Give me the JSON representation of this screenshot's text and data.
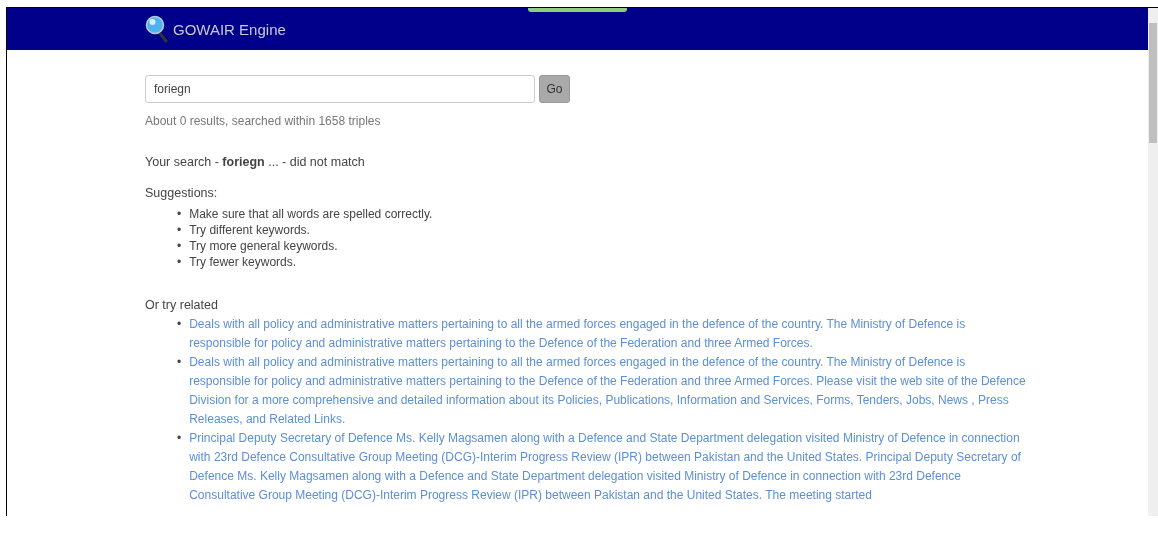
{
  "header": {
    "brand": "GOWAIR Engine"
  },
  "search": {
    "value": "foriegn",
    "button": "Go"
  },
  "result_count": "About 0 results, searched within 1658 triples",
  "no_match": "Your search - **foriegn** ... - did not match",
  "suggestions": {
    "title": "Suggestions:",
    "items": [
      {
        "bullet": "•",
        "text": "Make sure that all words are spelled correctly."
      },
      {
        "bullet": "•",
        "text": "Try different keywords."
      },
      {
        "bullet": "•",
        "text": "Try more general keywords."
      },
      {
        "bullet": "•",
        "text": "Try fewer keywords."
      }
    ]
  },
  "related": {
    "title": "Or try related",
    "items": [
      {
        "bullet": "•",
        "text": "Deals with all policy and administrative matters pertaining to all the armed forces engaged in the defence of the country. The Ministry of Defence is responsible for policy and administrative matters pertaining to the Defence of the Federation and three Armed Forces."
      },
      {
        "bullet": "•",
        "text": "Deals with all policy and administrative matters pertaining to all the armed forces engaged in the defence of the country. The Ministry of Defence is responsible for policy and administrative matters pertaining to the Defence of the Federation and three Armed Forces. Please visit the web site of the Defence Division for a more comprehensive and detailed information about its Policies, Publications, Information and Services, Forms, Tenders, Jobs, News , Press Releases, and Related Links."
      },
      {
        "bullet": "•",
        "text": "Principal Deputy Secretary of Defence Ms. Kelly Magsamen along with a Defence and State Department delegation visited Ministry of Defence in connection with 23rd Defence Consultative Group Meeting (DCG)-Interim Progress Review (IPR) between Pakistan and the United States. Principal Deputy Secretary of Defence Ms. Kelly Magsamen along with a Defence and State Department delegation visited Ministry of Defence in connection with 23rd Defence Consultative Group Meeting (DCG)-Interim Progress Review (IPR) between Pakistan and the United States. The meeting started"
      }
    ]
  }
}
